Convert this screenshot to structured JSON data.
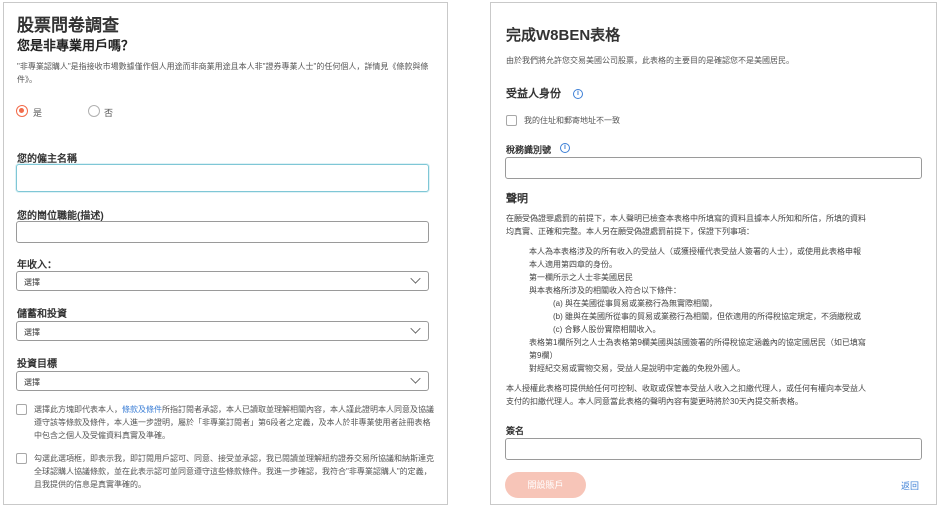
{
  "questionnaire": {
    "title": "股票問卷調查",
    "subtitle": "您是非專業用戶嗎？",
    "intro_text": "\"非專業認購人\"是指接收市場數據僅作個人用途而非商業用途且本人非\"證券專業人士\"的任何個人，詳情見《條款與條件》。",
    "radio_yes": "是",
    "radio_no": "否",
    "employer_label": "您的僱主名稱",
    "employer_value": "",
    "job_label": "您的崗位職能(描述)",
    "job_value": "",
    "income_label": "年收入：",
    "income_value": "選擇",
    "savings_label": "儲蓄和投資",
    "savings_value": "選擇",
    "goal_label": "投資目標",
    "goal_value": "選擇",
    "consent1_pre": "選擇此方塊即代表本人，",
    "consent1_link": "條款及條件",
    "consent1_post": "所指訂閱者承認，本人已讀取並理解相關內容，本人謹此證明本人同意及協議遵守該等條款及條件，本人進一步證明，屬於「非專業訂閱者」第6段者之定義，及本人於非專業使用者註冊表格中包含之個人及受僱資料真實及準確。",
    "consent2": "勾選此選項框，即表示我，即訂閱用戶認可、同意、接受並承認，我已閱讀並理解紐約證券交易所協議和納斯達克全球認購人協議條款，並在此表示認可並同意遵守這些條款條件。我進一步確認，我符合\"非專業認購人\"的定義，且我提供的信息是真實準確的。"
  },
  "w8ben": {
    "title": "完成W8BEN表格",
    "intro": "由於我們將允許您交易美國公司股票，此表格的主要目的是確認您不是美國居民。",
    "beneficiary_label": "受益人身份",
    "address_checkbox": "我的住址和郵寄地址不一致",
    "tin_label": "稅務識別號",
    "tin_value": "",
    "declaration_heading": "聲明",
    "decl_lines": [
      "在願受偽證罪處罰的前提下，本人聲明已檢查本表格中所填寫的資料且據本人所知和所信，所填的資料",
      "均真實、正確和完整。本人另在願受偽證處罰前提下，保證下列事項：",
      "本人為本表格涉及的所有收入的受益人（或獲授權代表受益人簽署的人士），或使用此表格申報",
      "本人適用第四章的身份。",
      "第一欄所示之人士非美國居民",
      "與本表格所涉及的相關收入符合以下條件：",
      "(a) 與在美國從事貿易或業務行為無實際相關，",
      "(b) 雖與在美國所從事的貿易或業務行為相關，但依適用的所得稅協定規定，不須繳稅或",
      "(c) 合夥人股份實際相關收入。",
      "表格第1欄所列之人士為表格第9欄美國與該國簽署的所得稅協定涵義內的協定國居民（如已填寫",
      "第9欄）",
      "對經紀交易或實物交易，受益人是說明中定義的免稅外國人。",
      "本人授權此表格可提供給任何可控制、收取或保管本受益人收入之扣繳代理人，或任何有權向本受益人",
      "支付的扣繳代理人。本人同意當此表格的聲明內容有變更時將於30天內提交新表格。"
    ],
    "signature_label": "簽名",
    "signature_value": "",
    "open_button": "開設賬戶",
    "back_link": "返回"
  }
}
